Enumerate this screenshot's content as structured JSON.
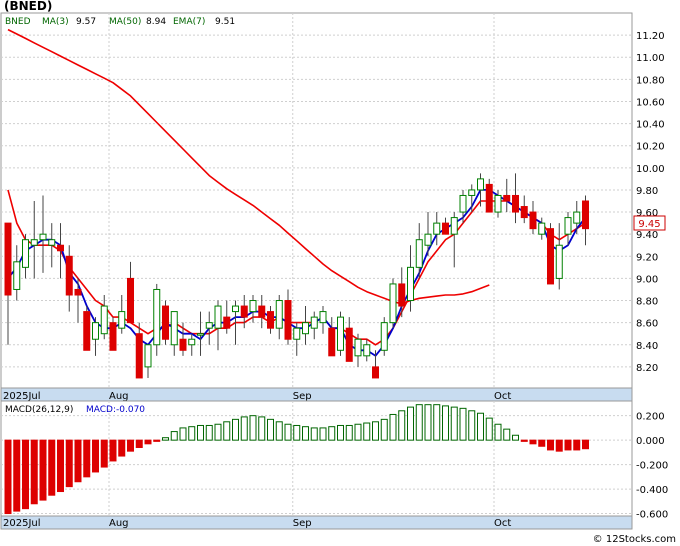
{
  "chart_data": [
    {
      "type": "candlestick",
      "ticker": "(BNED)",
      "legend": {
        "ticker": "BNED",
        "ma3_label": "MA(3)",
        "ma3_value": "9.57",
        "ma50_label": "MA(50)",
        "ma50_value": "8.94",
        "ema7_label": "EMA(7)",
        "ema7_value": "9.51"
      },
      "last_price_label": "9.45",
      "ylim": [
        8.0,
        11.4
      ],
      "y_ticks": [
        "11.20",
        "11.00",
        "10.80",
        "10.60",
        "10.40",
        "10.20",
        "10.00",
        "9.80",
        "9.60",
        "9.40",
        "9.20",
        "9.00",
        "8.80",
        "8.60",
        "8.40",
        "8.20"
      ],
      "x_labels": [
        {
          "label": "2025Jul",
          "index": 0
        },
        {
          "label": "Aug",
          "index": 12
        },
        {
          "label": "Sep",
          "index": 33
        },
        {
          "label": "Oct",
          "index": 56
        }
      ],
      "grid": true,
      "colors": {
        "up": "#008000",
        "down": "#dd0000",
        "ma_red": "#ee0000",
        "ma_blue": "#0000cc",
        "axis_bar": "#c8dcf0"
      },
      "candles": [
        [
          9.5,
          9.5,
          8.4,
          8.85
        ],
        [
          8.9,
          9.3,
          8.8,
          9.15
        ],
        [
          9.1,
          9.4,
          9.0,
          9.35
        ],
        [
          9.3,
          9.7,
          9.0,
          9.35
        ],
        [
          9.35,
          9.75,
          9.05,
          9.4
        ],
        [
          9.3,
          9.5,
          9.1,
          9.35
        ],
        [
          9.3,
          9.5,
          9.0,
          9.25
        ],
        [
          9.2,
          9.3,
          8.7,
          8.85
        ],
        [
          8.9,
          9.0,
          8.6,
          8.85
        ],
        [
          8.7,
          8.75,
          8.35,
          8.35
        ],
        [
          8.45,
          8.65,
          8.3,
          8.6
        ],
        [
          8.5,
          8.85,
          8.45,
          8.75
        ],
        [
          8.6,
          8.65,
          8.35,
          8.35
        ],
        [
          8.55,
          8.85,
          8.5,
          8.7
        ],
        [
          9.0,
          9.15,
          8.6,
          8.6
        ],
        [
          8.5,
          8.6,
          8.1,
          8.1
        ],
        [
          8.2,
          8.4,
          8.1,
          8.4
        ],
        [
          8.4,
          8.95,
          8.3,
          8.9
        ],
        [
          8.75,
          8.8,
          8.4,
          8.45
        ],
        [
          8.4,
          8.7,
          8.3,
          8.7
        ],
        [
          8.45,
          8.6,
          8.3,
          8.35
        ],
        [
          8.4,
          8.5,
          8.3,
          8.45
        ],
        [
          8.5,
          8.7,
          8.3,
          8.5
        ],
        [
          8.55,
          8.7,
          8.4,
          8.6
        ],
        [
          8.55,
          8.8,
          8.35,
          8.75
        ],
        [
          8.65,
          8.8,
          8.5,
          8.55
        ],
        [
          8.7,
          8.8,
          8.4,
          8.75
        ],
        [
          8.75,
          8.85,
          8.55,
          8.65
        ],
        [
          8.7,
          8.85,
          8.6,
          8.8
        ],
        [
          8.75,
          8.85,
          8.55,
          8.65
        ],
        [
          8.7,
          8.75,
          8.5,
          8.55
        ],
        [
          8.55,
          8.85,
          8.45,
          8.8
        ],
        [
          8.8,
          8.9,
          8.4,
          8.45
        ],
        [
          8.45,
          8.6,
          8.3,
          8.55
        ],
        [
          8.5,
          8.75,
          8.4,
          8.6
        ],
        [
          8.55,
          8.7,
          8.45,
          8.65
        ],
        [
          8.6,
          8.75,
          8.5,
          8.7
        ],
        [
          8.55,
          8.65,
          8.3,
          8.3
        ],
        [
          8.35,
          8.7,
          8.3,
          8.65
        ],
        [
          8.55,
          8.65,
          8.25,
          8.25
        ],
        [
          8.3,
          8.5,
          8.2,
          8.45
        ],
        [
          8.3,
          8.45,
          8.25,
          8.4
        ],
        [
          8.2,
          8.35,
          8.1,
          8.1
        ],
        [
          8.35,
          8.65,
          8.3,
          8.6
        ],
        [
          8.6,
          9.0,
          8.55,
          8.95
        ],
        [
          8.95,
          9.1,
          8.65,
          8.75
        ],
        [
          8.8,
          9.3,
          8.7,
          9.1
        ],
        [
          9.1,
          9.5,
          9.0,
          9.35
        ],
        [
          9.3,
          9.6,
          9.2,
          9.4
        ],
        [
          9.4,
          9.6,
          9.3,
          9.5
        ],
        [
          9.5,
          9.55,
          9.4,
          9.4
        ],
        [
          9.4,
          9.6,
          9.1,
          9.55
        ],
        [
          9.6,
          9.8,
          9.5,
          9.75
        ],
        [
          9.75,
          9.85,
          9.6,
          9.8
        ],
        [
          9.8,
          9.95,
          9.65,
          9.9
        ],
        [
          9.85,
          9.9,
          9.6,
          9.6
        ],
        [
          9.6,
          9.8,
          9.55,
          9.75
        ],
        [
          9.75,
          9.9,
          9.6,
          9.7
        ],
        [
          9.75,
          9.95,
          9.5,
          9.6
        ],
        [
          9.65,
          9.75,
          9.5,
          9.55
        ],
        [
          9.6,
          9.7,
          9.4,
          9.45
        ],
        [
          9.4,
          9.55,
          9.35,
          9.5
        ],
        [
          9.45,
          9.5,
          8.95,
          8.95
        ],
        [
          9.0,
          9.5,
          8.9,
          9.3
        ],
        [
          9.4,
          9.6,
          9.3,
          9.55
        ],
        [
          9.5,
          9.7,
          9.4,
          9.6
        ],
        [
          9.7,
          9.75,
          9.3,
          9.45
        ]
      ],
      "ma3": [
        9.0,
        9.1,
        9.25,
        9.3,
        9.35,
        9.35,
        9.3,
        9.05,
        8.95,
        8.75,
        8.6,
        8.55,
        8.55,
        8.6,
        8.55,
        8.45,
        8.4,
        8.5,
        8.6,
        8.55,
        8.5,
        8.5,
        8.45,
        8.55,
        8.6,
        8.6,
        8.65,
        8.65,
        8.7,
        8.7,
        8.65,
        8.65,
        8.6,
        8.55,
        8.55,
        8.6,
        8.65,
        8.55,
        8.55,
        8.4,
        8.35,
        8.35,
        8.3,
        8.4,
        8.55,
        8.75,
        8.9,
        9.05,
        9.25,
        9.4,
        9.45,
        9.5,
        9.55,
        9.65,
        9.8,
        9.8,
        9.75,
        9.7,
        9.65,
        9.6,
        9.55,
        9.5,
        9.3,
        9.25,
        9.3,
        9.45,
        9.55
      ],
      "ema7": [
        9.8,
        9.5,
        9.35,
        9.3,
        9.3,
        9.3,
        9.25,
        9.1,
        9.0,
        8.9,
        8.8,
        8.75,
        8.65,
        8.65,
        8.6,
        8.55,
        8.5,
        8.55,
        8.55,
        8.6,
        8.55,
        8.5,
        8.5,
        8.5,
        8.55,
        8.55,
        8.6,
        8.6,
        8.65,
        8.65,
        8.6,
        8.65,
        8.6,
        8.6,
        8.6,
        8.6,
        8.65,
        8.55,
        8.55,
        8.5,
        8.45,
        8.45,
        8.4,
        8.45,
        8.55,
        8.7,
        8.85,
        9.0,
        9.15,
        9.25,
        9.35,
        9.4,
        9.5,
        9.6,
        9.7,
        9.7,
        9.7,
        9.7,
        9.65,
        9.6,
        9.55,
        9.5,
        9.4,
        9.35,
        9.4,
        9.45,
        9.5
      ],
      "ma50": [
        11.25,
        11.21,
        11.17,
        11.13,
        11.09,
        11.05,
        11.01,
        10.97,
        10.93,
        10.89,
        10.85,
        10.81,
        10.77,
        10.71,
        10.65,
        10.57,
        10.49,
        10.41,
        10.33,
        10.25,
        10.17,
        10.09,
        10.01,
        9.93,
        9.87,
        9.81,
        9.76,
        9.71,
        9.66,
        9.6,
        9.54,
        9.48,
        9.41,
        9.34,
        9.27,
        9.2,
        9.13,
        9.07,
        9.02,
        8.97,
        8.92,
        8.88,
        8.85,
        8.82,
        8.79,
        8.77,
        8.8,
        8.82,
        8.83,
        8.84,
        8.85,
        8.85,
        8.86,
        8.88,
        8.91,
        8.94
      ]
    },
    {
      "type": "bar",
      "title_label": "MACD(26,12,9)",
      "value_label": "MACD:-0.070",
      "ylim": [
        -0.62,
        0.32
      ],
      "y_ticks": [
        "0.200",
        "0.000",
        "-0.200",
        "-0.400",
        "-0.600"
      ],
      "x_labels": [
        "2025Jul",
        "Aug",
        "Sep",
        "Oct"
      ],
      "colors": {
        "positive": "#006600",
        "negative": "#dd0000"
      },
      "values": [
        -0.6,
        -0.58,
        -0.56,
        -0.52,
        -0.49,
        -0.45,
        -0.42,
        -0.38,
        -0.34,
        -0.3,
        -0.26,
        -0.22,
        -0.17,
        -0.13,
        -0.09,
        -0.06,
        -0.03,
        -0.01,
        0.02,
        0.07,
        0.1,
        0.11,
        0.12,
        0.12,
        0.13,
        0.15,
        0.17,
        0.19,
        0.2,
        0.19,
        0.17,
        0.15,
        0.13,
        0.12,
        0.11,
        0.1,
        0.1,
        0.11,
        0.12,
        0.12,
        0.13,
        0.14,
        0.15,
        0.17,
        0.21,
        0.24,
        0.27,
        0.29,
        0.29,
        0.29,
        0.28,
        0.27,
        0.26,
        0.24,
        0.22,
        0.18,
        0.13,
        0.09,
        0.04,
        -0.01,
        -0.03,
        -0.05,
        -0.08,
        -0.09,
        -0.08,
        -0.08,
        -0.07
      ]
    }
  ],
  "footer": {
    "copyright": "© 12Stocks.com"
  }
}
